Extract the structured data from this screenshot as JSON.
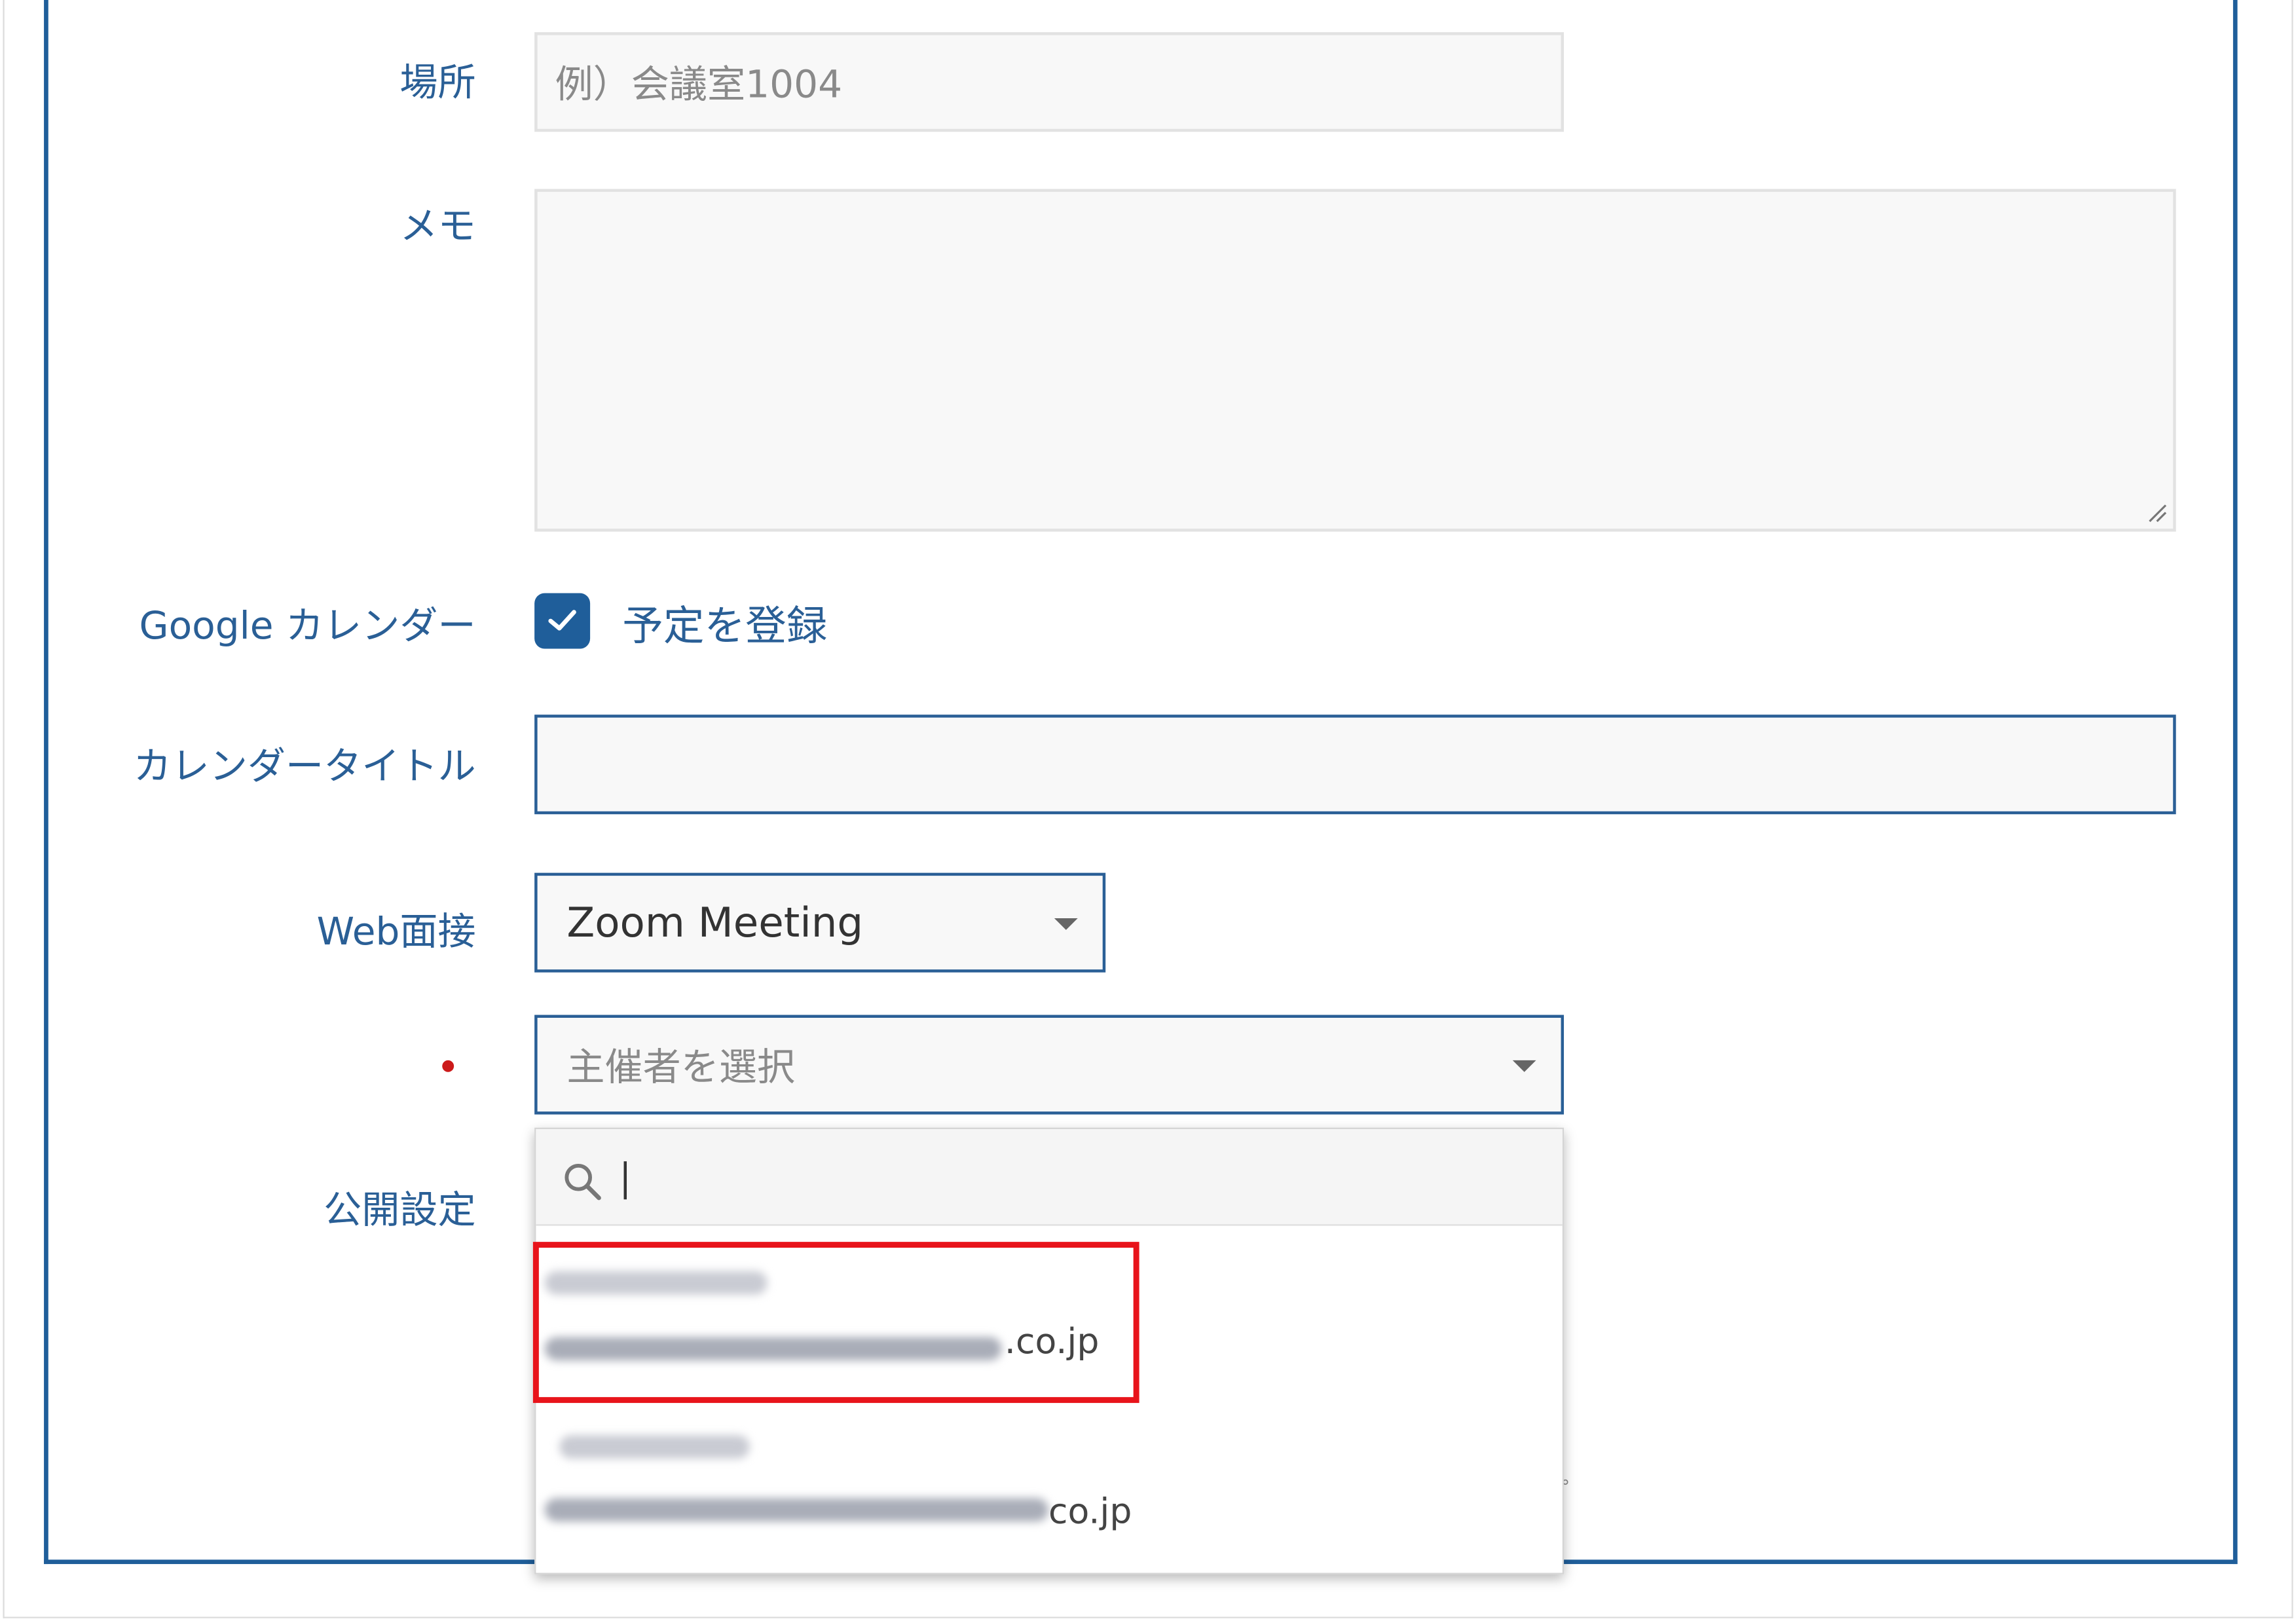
{
  "form": {
    "location": {
      "label": "場所",
      "placeholder": "例）会議室1004"
    },
    "memo": {
      "label": "メモ",
      "value": ""
    },
    "google_calendar": {
      "label": "Google カレンダー",
      "checkbox_label": "予定を登録",
      "checked": true
    },
    "calendar_title": {
      "label": "カレンダータイトル",
      "value": ""
    },
    "web_interview": {
      "label": "Web面接",
      "selected": "Zoom Meeting"
    },
    "organizer": {
      "label": "",
      "placeholder": "主催者を選択",
      "required": true
    },
    "visibility": {
      "label": "公開設定"
    }
  },
  "organizer_dropdown": {
    "search_value": "",
    "options": [
      {
        "name": "",
        "email_suffix": ".co.jp",
        "highlighted": true
      },
      {
        "name": "",
        "email_suffix": "co.jp",
        "highlighted": false
      }
    ]
  },
  "misc": {
    "stray_mark": "°"
  },
  "colors": {
    "accent": "#1f5e9a",
    "label": "#2a5f96",
    "required": "#cc1a1a",
    "highlight": "#e8141b"
  }
}
